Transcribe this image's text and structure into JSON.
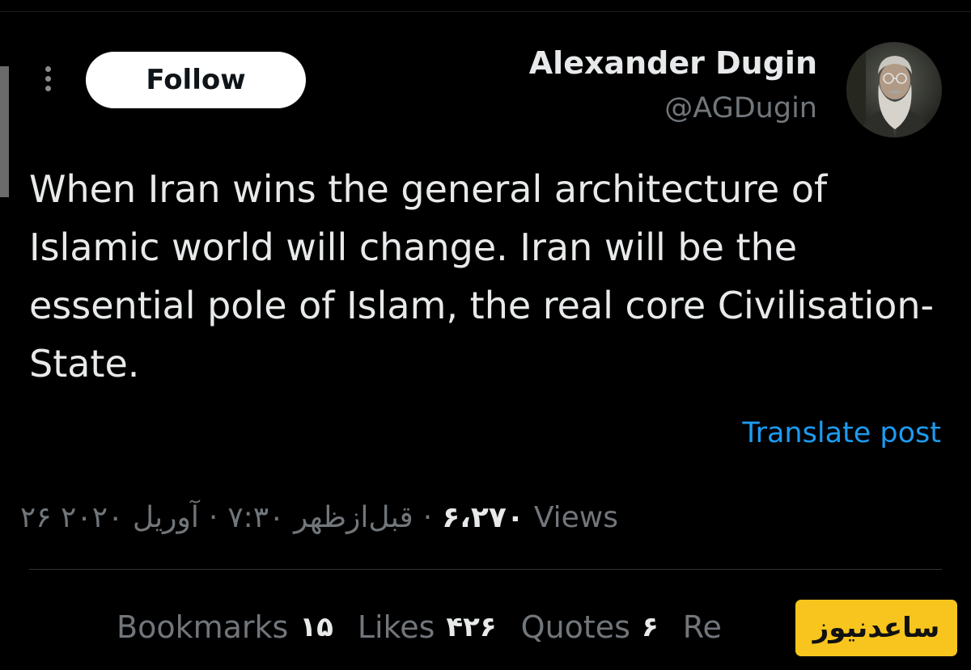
{
  "author": {
    "display_name": "Alexander Dugin",
    "handle": "@AGDugin",
    "avatar_icon": "avatar-photo"
  },
  "actions": {
    "follow_label": "Follow",
    "more_icon": "more-vertical-icon"
  },
  "post": {
    "text": "When Iran wins the general architecture of Islamic world will change. Iran will be the essential pole of Islam, the real core Civilisation-State.",
    "translate_label": "Translate post"
  },
  "meta": {
    "time": "۷:۳۰ قبل‌ازظهر",
    "date": "۲۶ آوریل ۲۰۲۰",
    "views_count": "۶،۲۷۰",
    "views_label": "Views"
  },
  "stats": [
    {
      "label": "Bookmarks",
      "count": "۱۵"
    },
    {
      "label": "Likes",
      "count": "۴۲۶"
    },
    {
      "label": "Quotes",
      "count": "۶"
    },
    {
      "label": "Re",
      "count": ""
    }
  ],
  "watermark": {
    "text": "ساعدنیوز"
  },
  "colors": {
    "background": "#000000",
    "text_primary": "#e7e9ea",
    "text_secondary": "#71767b",
    "link": "#1d9bf0",
    "badge": "#f7c51e"
  }
}
